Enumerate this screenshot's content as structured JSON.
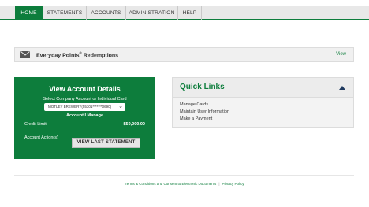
{
  "nav": {
    "items": [
      {
        "label": "HOME"
      },
      {
        "label": "STATEMENTS"
      },
      {
        "label": "ACCOUNTS"
      },
      {
        "label": "ADMINISTRATION"
      },
      {
        "label": "HELP"
      }
    ],
    "active": "HOME"
  },
  "points": {
    "title": "Everyday Points",
    "trademark": "®",
    "title_suffix": " Redemptions",
    "view_label": "View"
  },
  "account": {
    "title": "View Account Details",
    "select_label": "Select Company Account or Individual Card",
    "selected_value": "MOTLEY BREWERY(55301*******0690)",
    "manage_text": "Account I Manage",
    "credit_limit_label": "Credit Limit",
    "credit_limit_value": "$50,000.00",
    "actions_label": "Account Action(s)",
    "button_label": "VIEW LAST STATEMENT"
  },
  "quick_links": {
    "title": "Quick Links",
    "links": [
      {
        "label": "Manage Cards"
      },
      {
        "label": "Maintain User Information"
      },
      {
        "label": "Make a Payment"
      }
    ]
  },
  "footer": {
    "terms_link": "Terms & Conditions and Consent to Electronic Documents",
    "separator": "|",
    "privacy_link": "Privacy Policy"
  },
  "colors": {
    "brand_green": "#0d7d3c",
    "nav_bg": "#e8e8e8",
    "toggle_arrow": "#1f3a5f"
  }
}
